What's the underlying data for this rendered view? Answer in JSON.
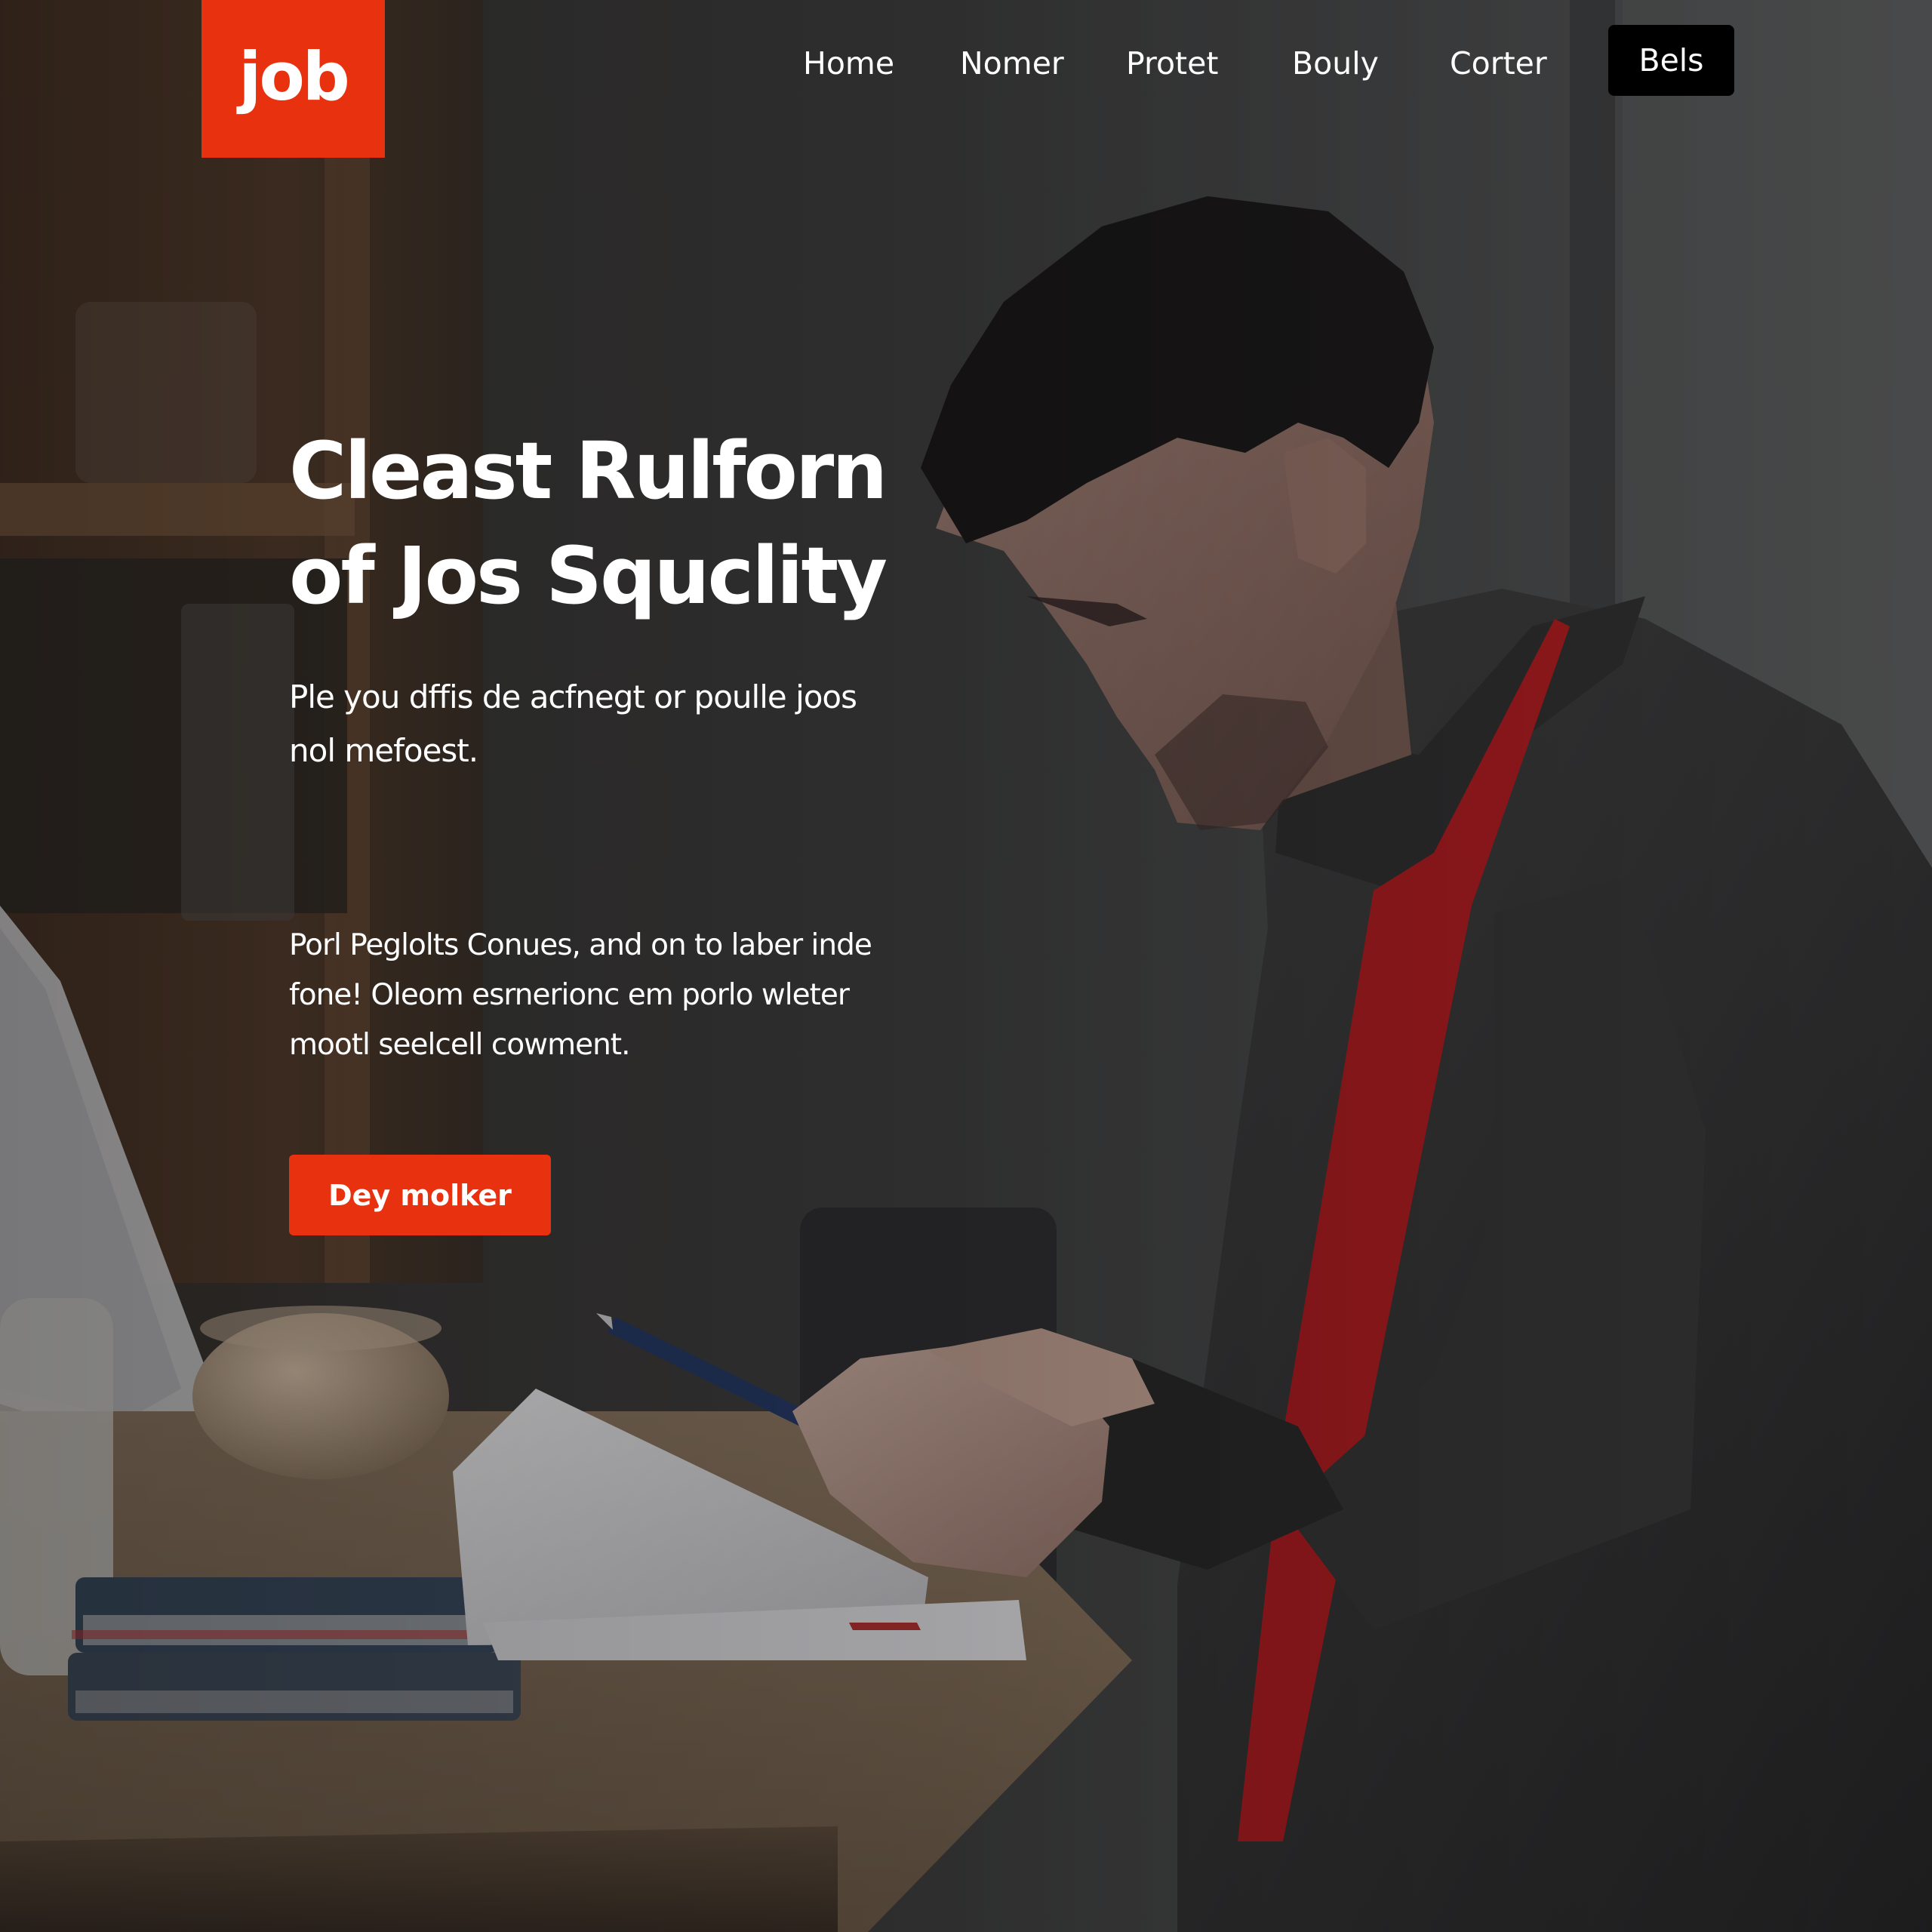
{
  "brand": {
    "logo_text": "job",
    "accent_color": "#e8320f"
  },
  "nav": {
    "items": [
      {
        "label": "Home"
      },
      {
        "label": "Nomer"
      },
      {
        "label": "Protet"
      },
      {
        "label": "Bouly"
      },
      {
        "label": "Corter"
      }
    ],
    "cta_label": "Bels"
  },
  "hero": {
    "title_lines": [
      "Cleast Rulforn",
      "of Jos Squclity"
    ],
    "lead_lines": [
      "Ple you dffis de acfnegt or poulle joos",
      "nol mefoest."
    ],
    "body_lines": [
      "Porl Peglolts Conues, and on to laber inde",
      "fone! Oleom esrnerionc em porlo wleter",
      "mootl seelcell cowment."
    ],
    "cta_label": "Dey molker"
  },
  "background": {
    "image": "man-in-dark-shirt-writing-on-paper-at-desk"
  }
}
